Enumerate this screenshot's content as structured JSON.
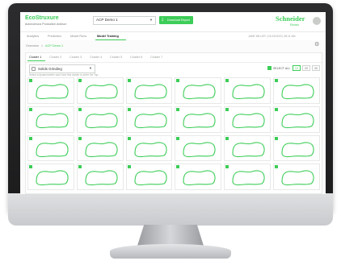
{
  "app": {
    "brand": "EcoStruxure",
    "brand_sub": "Autonomous Production Advisor",
    "asset_select": "ACP Demo 1",
    "download_label": "Download Report",
    "company": "Schneider",
    "company_sub": "Electric"
  },
  "nav": {
    "items": [
      "Analytics",
      "Prediction",
      "Model Runs",
      "Model Training"
    ],
    "active": "Model Training",
    "user": "JANE MILLER | 01/13/2020 | 08:11 AM"
  },
  "breadcrumb": [
    "Overview",
    "ACP Demo 1"
  ],
  "clusters": {
    "tabs": [
      "Cluster 1",
      "Cluster 2",
      "Cluster 3",
      "Cluster 4",
      "Cluster 5",
      "Cluster 6",
      "Cluster 7"
    ],
    "active": "Cluster 1",
    "type_select": "Solids Grinding",
    "hint": "Select a dynamometer card from this cluster to enter the Top...",
    "select_all_label": "SELECT ALL",
    "zoom_options": [
      "1X",
      "2X",
      "3X"
    ],
    "zoom_active": "1X",
    "rows": 4,
    "cols": 6,
    "all_selected": true
  },
  "colors": {
    "accent": "#3dcd58",
    "curve": "#3dcd58"
  },
  "icons": {
    "settings": "gear-icon",
    "download": "download-icon",
    "dropdown": "chevron-down-icon",
    "avatar": "user-avatar"
  }
}
